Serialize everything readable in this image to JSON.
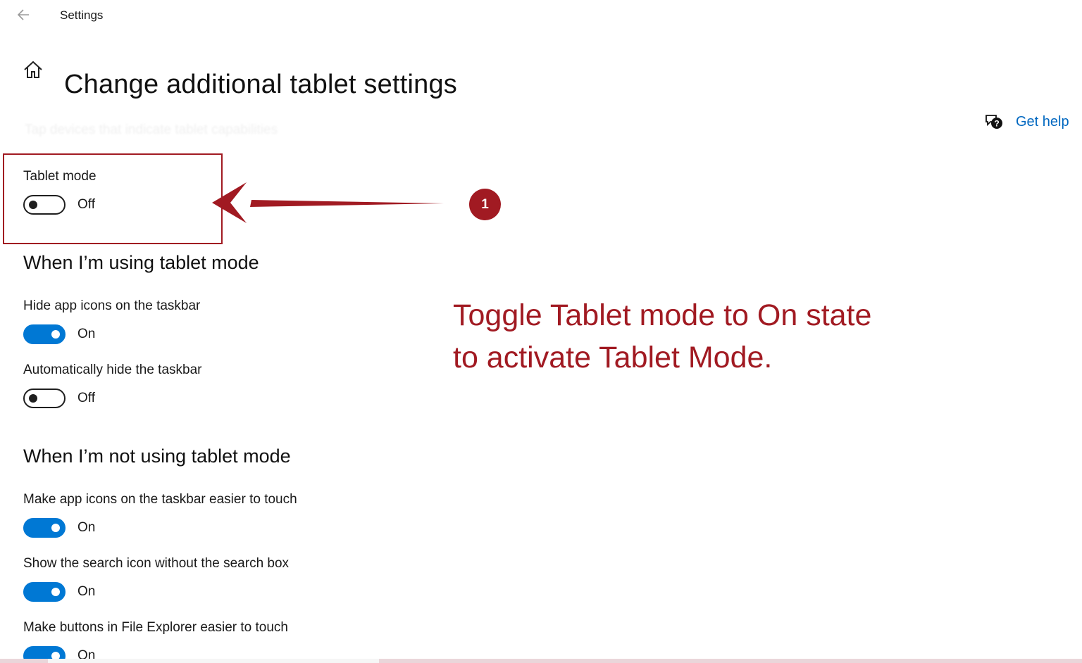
{
  "window": {
    "title": "Settings"
  },
  "page": {
    "title": "Change additional tablet settings"
  },
  "ghost_text": "Tap devices that indicate tablet capabilities",
  "help": {
    "label": "Get help"
  },
  "tablet_mode": {
    "label": "Tablet mode",
    "state": "Off",
    "on": false
  },
  "section_using": {
    "heading": "When I’m using tablet mode",
    "items": [
      {
        "label": "Hide app icons on the taskbar",
        "state": "On",
        "on": true
      },
      {
        "label": "Automatically hide the taskbar",
        "state": "Off",
        "on": false
      }
    ]
  },
  "section_not_using": {
    "heading": "When I’m not using tablet mode",
    "items": [
      {
        "label": "Make app icons on the taskbar easier to touch",
        "state": "On",
        "on": true
      },
      {
        "label": "Show the search icon without the search box",
        "state": "On",
        "on": true
      },
      {
        "label": "Make buttons in File Explorer easier to touch",
        "state": "On",
        "on": true
      }
    ]
  },
  "annotation": {
    "step": "1",
    "line1": "Toggle Tablet mode to On state",
    "line2": "to activate Tablet Mode.",
    "color": "#a11a22"
  },
  "colors": {
    "accent": "#0078d4",
    "link": "#0067c0"
  },
  "icons": {
    "back": "back-arrow-icon",
    "home": "home-icon",
    "help": "help-chat-icon"
  }
}
